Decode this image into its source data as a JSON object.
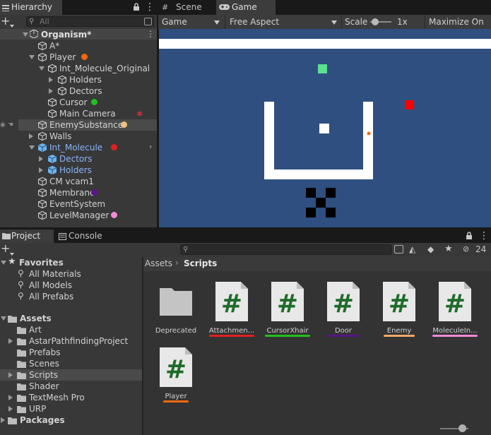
{
  "hierarchy": {
    "tab_label": "Hierarchy",
    "search_placeholder": "All",
    "root": "Organism*",
    "items": [
      {
        "label": "A*"
      },
      {
        "label": "Player"
      },
      {
        "label": "Int_Molecule_Original"
      },
      {
        "label": "Holders"
      },
      {
        "label": "Dectors"
      },
      {
        "label": "Cursor"
      },
      {
        "label": "Main Camera"
      },
      {
        "label": "EnemySubstance"
      },
      {
        "label": "Walls"
      },
      {
        "label": "Int_Molecule"
      },
      {
        "label": "Dectors"
      },
      {
        "label": "Holders"
      },
      {
        "label": "CM vcam1"
      },
      {
        "label": "Membrane"
      },
      {
        "label": "EventSystem"
      },
      {
        "label": "LevelManager"
      }
    ]
  },
  "game_view": {
    "tabs": [
      "Scene",
      "Game"
    ],
    "display_dropdown": "Game",
    "aspect_dropdown": "Free Aspect",
    "scale_label": "Scale",
    "scale_value": "1x",
    "maximize_label": "Maximize On Pl",
    "background_color": "#2e4f7f"
  },
  "project": {
    "tabs": [
      "Project",
      "Console"
    ],
    "hidden_count": "24",
    "favorites_label": "Favorites",
    "favorites": [
      "All Materials",
      "All Models",
      "All Prefabs"
    ],
    "assets_label": "Assets",
    "assets_folders": [
      "Art",
      "AstarPathfindingProject",
      "Prefabs",
      "Scenes",
      "Scripts",
      "Shader",
      "TextMesh Pro",
      "URP"
    ],
    "packages_label": "Packages",
    "breadcrumb": [
      "Assets",
      "Scripts"
    ],
    "files": [
      {
        "name": "Deprecated",
        "type": "folder"
      },
      {
        "name": "Attachmen...",
        "type": "script",
        "underline": "#e0201e"
      },
      {
        "name": "CursorXhair",
        "type": "script",
        "underline": "#22c01e"
      },
      {
        "name": "Door",
        "type": "script",
        "underline": "#5a138a"
      },
      {
        "name": "Enemy",
        "type": "script",
        "underline": "#f2a86a"
      },
      {
        "name": "MoleculeIn...",
        "type": "script",
        "underline": "#f08ad8"
      },
      {
        "name": "Player",
        "type": "script",
        "underline": "#f06a10"
      }
    ]
  },
  "colors": {
    "player_dot": "#f06a10",
    "cursor_dot": "#22c01e",
    "enemy_dot": "#f2c080",
    "int_molecule_dot": "#e0201e",
    "membrane_dot": "#5a138a",
    "levelmanager_dot": "#f08ad8",
    "script_hash": "#1f6b2a"
  }
}
